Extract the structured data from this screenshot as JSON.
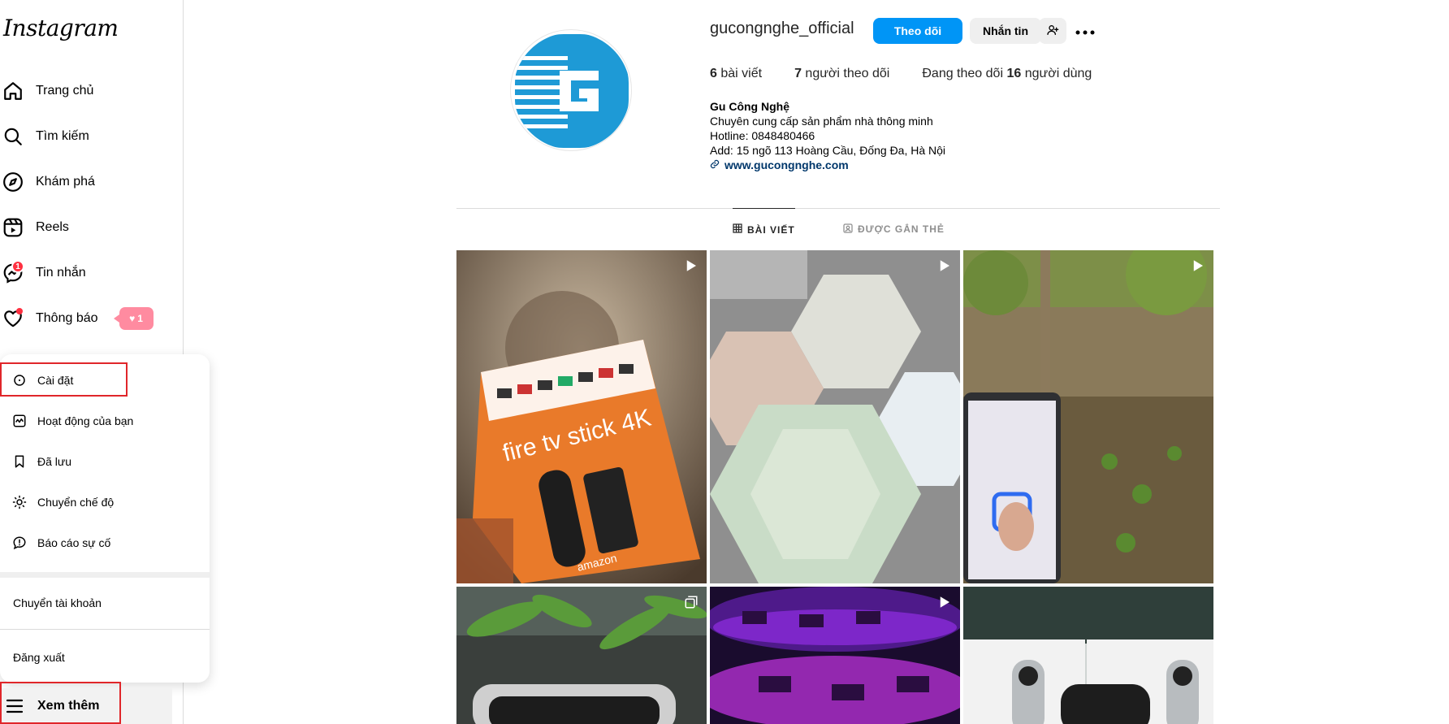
{
  "sidebar": {
    "logo": "Instagram",
    "items": [
      {
        "label": "Trang chủ",
        "icon": "home-icon"
      },
      {
        "label": "Tìm kiếm",
        "icon": "search-icon"
      },
      {
        "label": "Khám phá",
        "icon": "explore-icon"
      },
      {
        "label": "Reels",
        "icon": "reels-icon"
      },
      {
        "label": "Tin nhắn",
        "icon": "messenger-icon",
        "badge": "1"
      },
      {
        "label": "Thông báo",
        "icon": "heart-icon",
        "pill_count": "1"
      }
    ],
    "more_label": "Xem thêm"
  },
  "menu": {
    "items": [
      {
        "label": "Cài đặt",
        "icon": "settings-icon"
      },
      {
        "label": "Hoạt động của bạn",
        "icon": "activity-icon"
      },
      {
        "label": "Đã lưu",
        "icon": "bookmark-icon"
      },
      {
        "label": "Chuyển chế độ",
        "icon": "sun-icon"
      },
      {
        "label": "Báo cáo sự cố",
        "icon": "report-icon"
      }
    ],
    "switch_account": "Chuyển tài khoản",
    "logout": "Đăng xuất"
  },
  "profile": {
    "username": "gucongnghe_official",
    "follow_label": "Theo dõi",
    "message_label": "Nhắn tin",
    "posts_count": "6",
    "posts_label": "bài viết",
    "followers_count": "7",
    "followers_label": "người theo dõi",
    "following_prefix": "Đang theo dõi",
    "following_count": "16",
    "following_label": "người dùng",
    "bio_name": "Gu Công Nghệ",
    "bio_lines": [
      "Chuyên cung cấp sản phẩm nhà thông minh",
      "Hotline: 0848480466",
      "Add: 15 ngõ 113 Hoàng Cầu, Đống Đa, Hà Nội"
    ],
    "website": "www.gucongnghe.com"
  },
  "tabs": {
    "posts": "BÀI VIẾT",
    "tagged": "ĐƯỢC GẮN THẺ"
  },
  "colors": {
    "accent": "#0095f6",
    "badge": "#ff3040",
    "highlight_box": "#e0262a",
    "link": "#00376b"
  },
  "grid_posts": [
    {
      "type": "reel",
      "subject": "fire-tv-stick-box"
    },
    {
      "type": "reel",
      "subject": "hexagon-lights"
    },
    {
      "type": "reel",
      "subject": "smart-switch-garden"
    },
    {
      "type": "carousel",
      "subject": "plant-display"
    },
    {
      "type": "reel",
      "subject": "rgb-led-strip"
    },
    {
      "type": "photo",
      "subject": "apple-tv-boxes"
    }
  ]
}
